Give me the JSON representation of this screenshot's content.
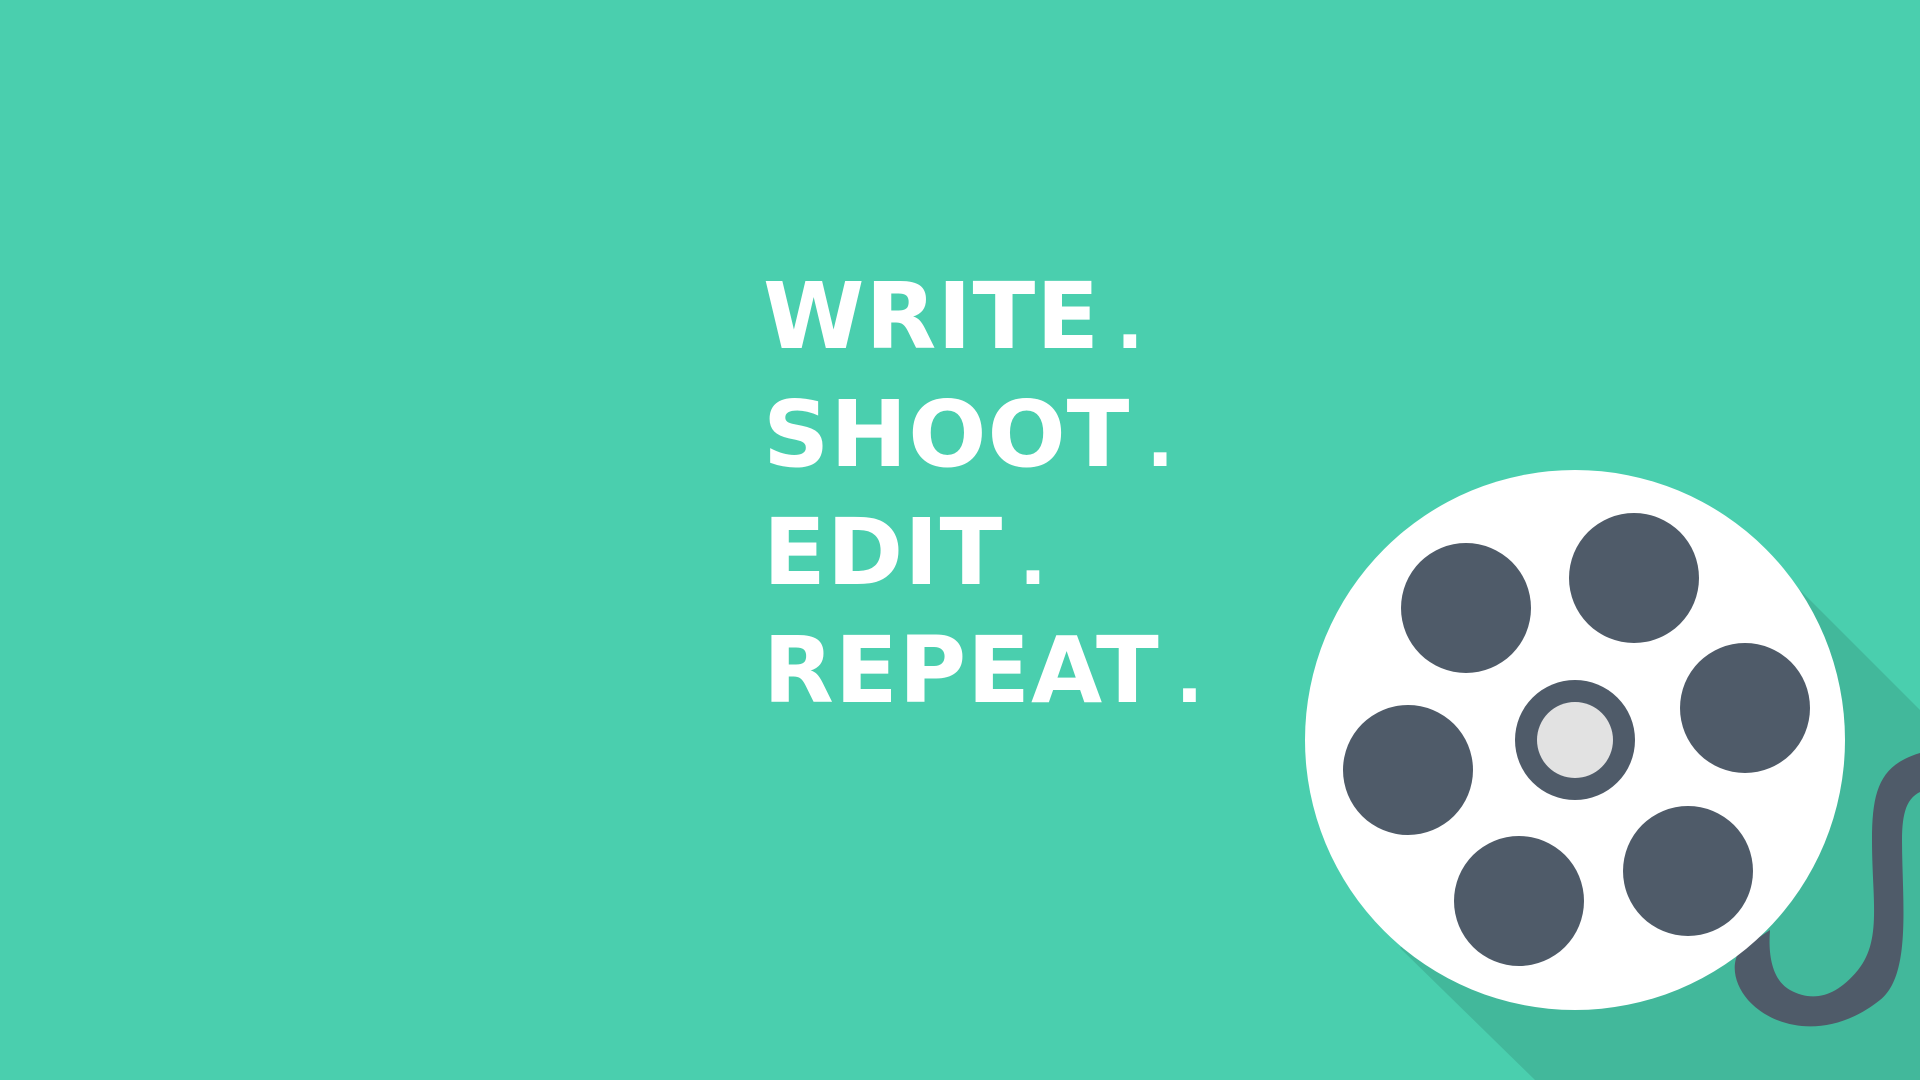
{
  "colors": {
    "background": "#4acfae",
    "shadow": "#42b89b",
    "reel_face": "#ffffff",
    "reel_holes": "#4f5b69",
    "reel_hub": "#e2e2e2",
    "text": "#ffffff"
  },
  "tagline": [
    {
      "word": "WRITE",
      "dot": "."
    },
    {
      "word": "SHOOT",
      "dot": "."
    },
    {
      "word": "EDIT",
      "dot": "."
    },
    {
      "word": "REPEAT",
      "dot": "."
    }
  ],
  "illustration": {
    "icon": "film-reel-icon"
  }
}
